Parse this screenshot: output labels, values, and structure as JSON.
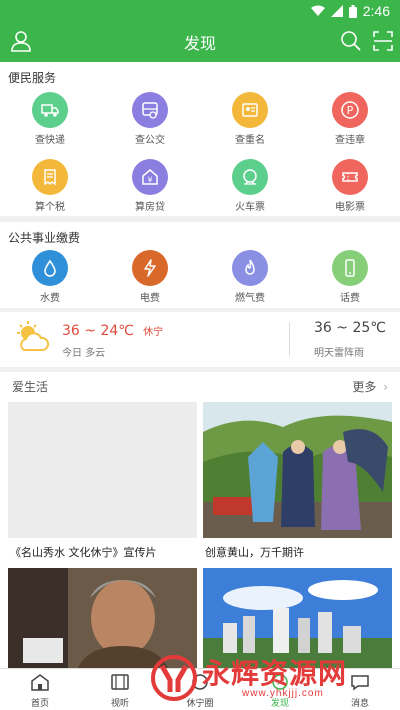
{
  "status": {
    "time": "2:46"
  },
  "header": {
    "title": "发现"
  },
  "services": {
    "title": "便民服务",
    "items": [
      {
        "label": "查快递",
        "icon": "truck-icon",
        "color": "#5ccf8d"
      },
      {
        "label": "查公交",
        "icon": "bus-icon",
        "color": "#8c7ee0"
      },
      {
        "label": "查重名",
        "icon": "id-card-icon",
        "color": "#f3b73a"
      },
      {
        "label": "查违章",
        "icon": "parking-icon",
        "color": "#f0655e"
      },
      {
        "label": "算个税",
        "icon": "receipt-icon",
        "color": "#f3b73a"
      },
      {
        "label": "算房贷",
        "icon": "house-yen-icon",
        "color": "#8c7ee0"
      },
      {
        "label": "火车票",
        "icon": "train-icon",
        "color": "#5ccf8d"
      },
      {
        "label": "电影票",
        "icon": "ticket-icon",
        "color": "#f0655e"
      }
    ]
  },
  "utilities": {
    "title": "公共事业缴费",
    "items": [
      {
        "label": "水费",
        "icon": "water-drop-icon",
        "color": "#2f8fd8"
      },
      {
        "label": "电费",
        "icon": "lightning-icon",
        "color": "#d9692a"
      },
      {
        "label": "燃气费",
        "icon": "flame-icon",
        "color": "#8a8fe3"
      },
      {
        "label": "话费",
        "icon": "phone-icon",
        "color": "#86cf78"
      }
    ]
  },
  "weather": {
    "today_temp": "36 ~ 24℃",
    "city": "休宁",
    "today_desc": "今日 多云",
    "tomorrow_temp": "36 ~ 25℃",
    "tomorrow_desc": "明天雷阵雨"
  },
  "life": {
    "title": "爱生活",
    "more": "更多",
    "cards": [
      {
        "caption": "《名山秀水 文化休宁》宣传片"
      },
      {
        "caption": "创意黄山，万千期许"
      },
      {
        "caption": ""
      },
      {
        "caption": ""
      }
    ]
  },
  "nav": {
    "items": [
      {
        "label": "首页",
        "icon": "home-icon"
      },
      {
        "label": "视听",
        "icon": "film-icon"
      },
      {
        "label": "休宁圈",
        "icon": "circle-icon"
      },
      {
        "label": "发现",
        "icon": "discover-icon"
      },
      {
        "label": "消息",
        "icon": "message-icon"
      }
    ]
  },
  "watermark": {
    "text": "永辉资源网",
    "url": "www.yhkjjj.com"
  }
}
